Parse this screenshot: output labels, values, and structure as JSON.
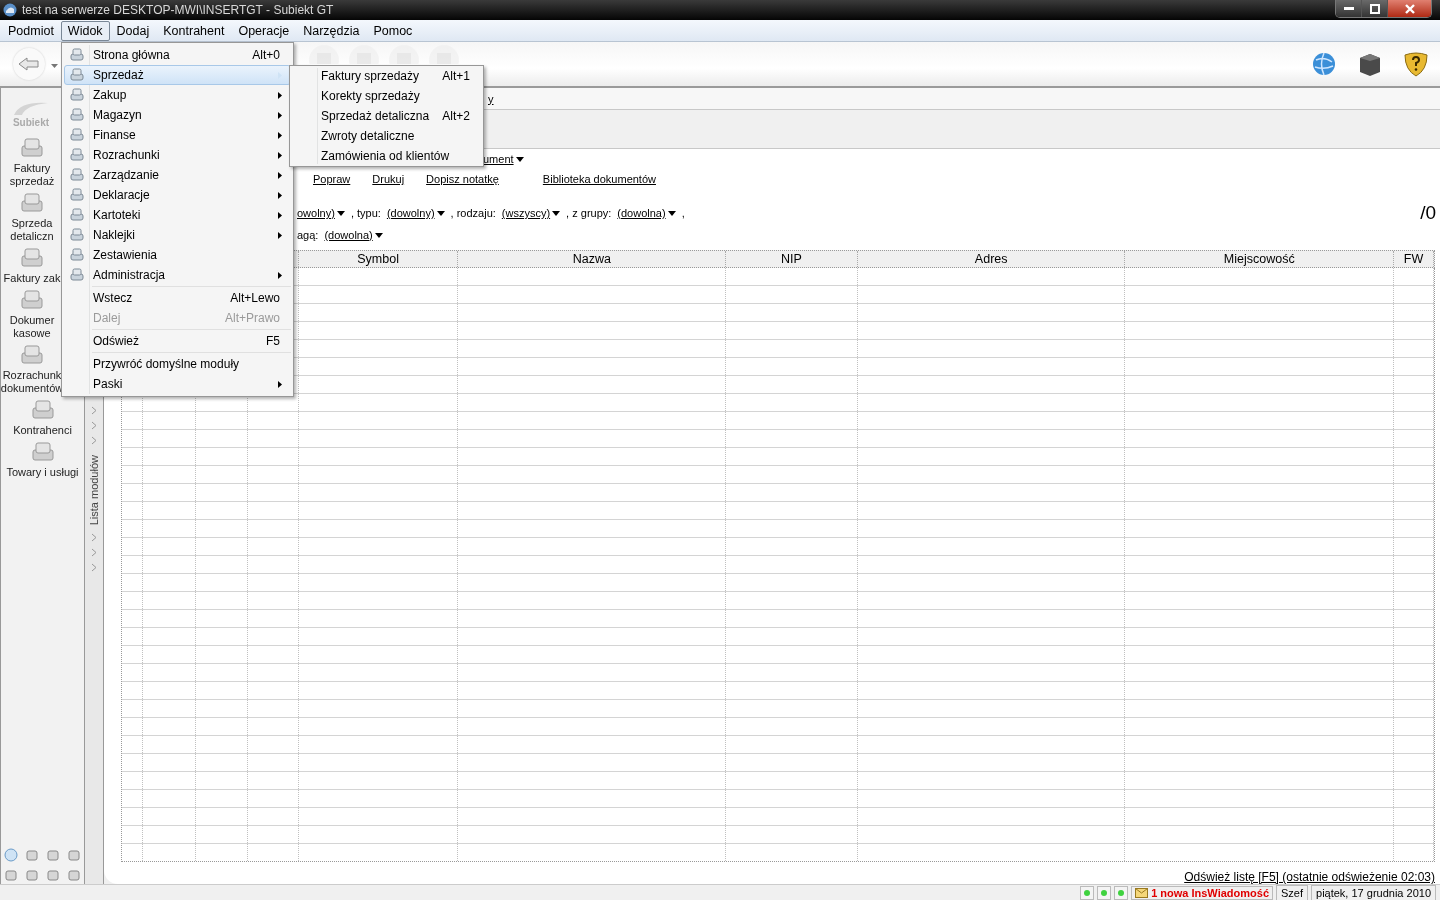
{
  "window": {
    "title": "test na serwerze DESKTOP-MWI\\INSERTGT - Subiekt GT"
  },
  "menubar": [
    {
      "label": "Podmiot",
      "selected": false
    },
    {
      "label": "Widok",
      "selected": true
    },
    {
      "label": "Dodaj",
      "selected": false
    },
    {
      "label": "Kontrahent",
      "selected": false
    },
    {
      "label": "Operacje",
      "selected": false
    },
    {
      "label": "Narzędzia",
      "selected": false
    },
    {
      "label": "Pomoc",
      "selected": false
    }
  ],
  "sidebar": {
    "logo_text": "Subiekt",
    "items": [
      {
        "label": "Faktury sprzedaż"
      },
      {
        "label": "Sprzeda detaliczn"
      },
      {
        "label": "Faktury zak"
      },
      {
        "label": "Dokumer kasowe"
      },
      {
        "label": "Rozrachunk dokumentów"
      },
      {
        "label": "Kontrahenci"
      },
      {
        "label": "Towary i usługi"
      }
    ],
    "strip_label": "Lista modułów"
  },
  "header_fragment": "y",
  "document_link": "ument",
  "actions": [
    "Popraw",
    "Drukuj",
    "Dopisz notatkę",
    "Biblioteka dokumentów"
  ],
  "filters": [
    [
      {
        "kind": "dropdown",
        "text": "owolny)"
      },
      {
        "kind": "label",
        "text": ", typu:"
      },
      {
        "kind": "dropdown",
        "text": "(dowolny)"
      },
      {
        "kind": "label",
        "text": ", rodzaju:"
      },
      {
        "kind": "dropdown",
        "text": "(wszyscy)"
      },
      {
        "kind": "label",
        "text": ", z grupy:"
      },
      {
        "kind": "dropdown",
        "text": "(dowolna)"
      },
      {
        "kind": "label",
        "text": ","
      }
    ],
    [
      {
        "kind": "label",
        "text": "agą:"
      },
      {
        "kind": "dropdown",
        "text": "(dowolna)"
      }
    ]
  ],
  "count": "/0",
  "table": {
    "columns": [
      {
        "label": "Symbol"
      },
      {
        "label": "Nazwa"
      },
      {
        "label": "NIP"
      },
      {
        "label": "Adres"
      },
      {
        "label": "Miejscowość"
      },
      {
        "label": "FW"
      }
    ]
  },
  "refresh_link": "Odśwież listę [F5] (ostatnie odświeżenie 02:03)",
  "status_bar": {
    "message": "1 nowa InsWiadomość",
    "user": "Szef",
    "date": "piątek, 17 grudnia 2010"
  },
  "view_menu": {
    "groups": [
      {
        "with_icons": true,
        "items": [
          {
            "label": "Strona główna",
            "shortcut": "Alt+0",
            "submenu": false,
            "disabled": false,
            "selected": false
          },
          {
            "label": "Sprzedaż",
            "submenu": true,
            "disabled": false,
            "selected": true
          },
          {
            "label": "Zakup",
            "submenu": true,
            "disabled": false,
            "selected": false
          },
          {
            "label": "Magazyn",
            "submenu": true,
            "disabled": false,
            "selected": false
          },
          {
            "label": "Finanse",
            "submenu": true,
            "disabled": false,
            "selected": false
          },
          {
            "label": "Rozrachunki",
            "submenu": true,
            "disabled": false,
            "selected": false
          },
          {
            "label": "Zarządzanie",
            "submenu": true,
            "disabled": false,
            "selected": false
          },
          {
            "label": "Deklaracje",
            "submenu": true,
            "disabled": false,
            "selected": false
          },
          {
            "label": "Kartoteki",
            "submenu": true,
            "disabled": false,
            "selected": false
          },
          {
            "label": "Naklejki",
            "submenu": true,
            "disabled": false,
            "selected": false
          },
          {
            "label": "Zestawienia",
            "submenu": false,
            "disabled": false,
            "selected": false
          },
          {
            "label": "Administracja",
            "submenu": true,
            "disabled": false,
            "selected": false
          }
        ]
      },
      {
        "with_icons": false,
        "items": [
          {
            "label": "Wstecz",
            "shortcut": "Alt+Lewo",
            "submenu": false,
            "disabled": false,
            "selected": false
          },
          {
            "label": "Dalej",
            "shortcut": "Alt+Prawo",
            "submenu": false,
            "disabled": true,
            "selected": false
          }
        ]
      },
      {
        "with_icons": false,
        "items": [
          {
            "label": "Odśwież",
            "shortcut": "F5",
            "submenu": false,
            "disabled": false,
            "selected": false
          }
        ]
      },
      {
        "with_icons": false,
        "items": [
          {
            "label": "Przywróć domyślne moduły",
            "submenu": false,
            "disabled": false,
            "selected": false
          },
          {
            "label": "Paski",
            "submenu": true,
            "disabled": false,
            "selected": false
          }
        ]
      }
    ]
  },
  "submenu": {
    "items": [
      {
        "label": "Faktury sprzedaży",
        "shortcut": "Alt+1",
        "selected": false
      },
      {
        "label": "Korekty sprzedaży",
        "selected": false
      },
      {
        "label": "Sprzedaż detaliczna",
        "shortcut": "Alt+2",
        "selected": false
      },
      {
        "label": "Zwroty detaliczne",
        "selected": false
      },
      {
        "label": "Zamówienia od klientów",
        "selected": false
      }
    ]
  }
}
